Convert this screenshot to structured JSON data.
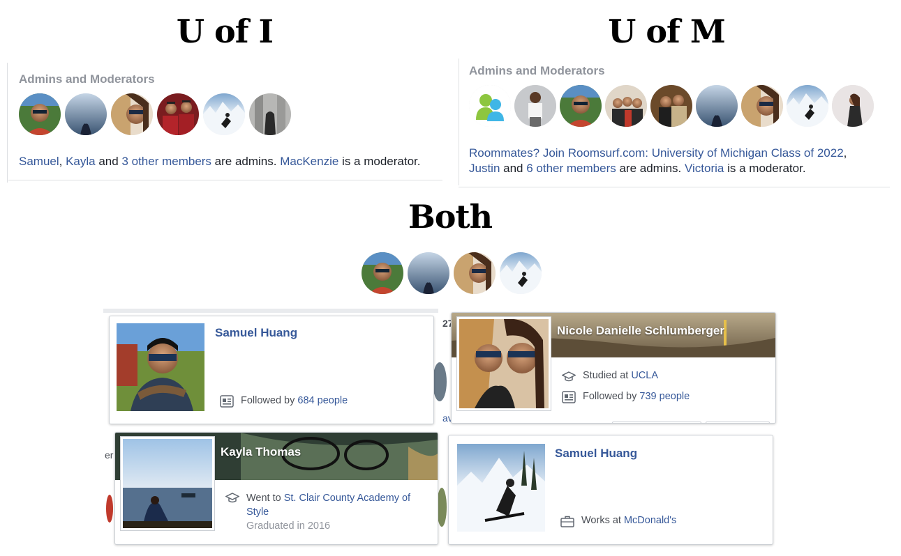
{
  "titles": {
    "left": "U of I",
    "right": "U of M",
    "both": "Both"
  },
  "uofi": {
    "header": "Admins and Moderators",
    "line": {
      "a": "Samuel",
      "sep1": ", ",
      "b": "Kayla",
      "and1": " and ",
      "c": "3 other members",
      "are": " are admins. ",
      "d": "MacKenzie",
      "mod": " is a moderator."
    }
  },
  "uofm": {
    "header": "Admins and Moderators",
    "line1": {
      "a": "Roommates? Join Roomsurf.com: University of Michigan Class of 2022",
      "comma": ","
    },
    "line2": {
      "a": "Justin",
      "and1": " and ",
      "b": "6 other members",
      "are": " are admins. ",
      "c": "Victoria",
      "mod": " is a moderator."
    }
  },
  "cards": {
    "samuel1": {
      "name": "Samuel Huang",
      "followed_prefix": "Followed by ",
      "followed_link": "684 people",
      "frag": "27"
    },
    "nicole": {
      "name": "Nicole Danielle Schlumberger",
      "studied_prefix": "Studied at ",
      "studied_link": "UCLA",
      "followed_prefix": "Followed by ",
      "followed_link": "739 people"
    },
    "kayla": {
      "name": "Kayla Thomas",
      "went_prefix": "Went to ",
      "went_link": "St. Clair County Academy of Style",
      "graduated": "Graduated in 2016"
    },
    "samuel2": {
      "name": "Samuel Huang",
      "works_prefix": "Works at ",
      "works_link": "McDonald's"
    }
  },
  "fragments": {
    "av": "av",
    "er": "er"
  },
  "icons": [
    "followed-icon",
    "graduation-cap-icon",
    "briefcase-icon",
    "group-icon"
  ],
  "colors": {
    "link": "#365899",
    "muted": "#90949c",
    "header": "#90949c",
    "text": "#1d2129"
  }
}
